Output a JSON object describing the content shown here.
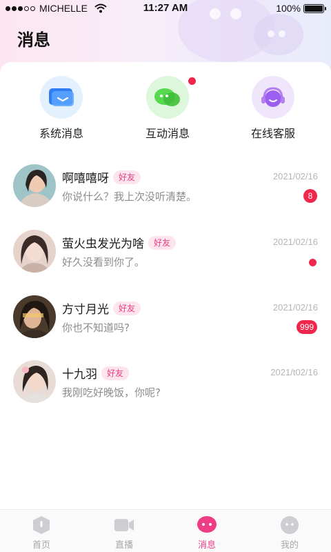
{
  "status_bar": {
    "carrier": "MICHELLE",
    "time": "11:27 AM",
    "battery": "100%"
  },
  "header": {
    "title": "消息"
  },
  "quick_entries": [
    {
      "label": "系统消息",
      "icon": "system-message-icon"
    },
    {
      "label": "互动消息",
      "icon": "interaction-message-icon",
      "has_dot": true
    },
    {
      "label": "在线客服",
      "icon": "customer-service-icon"
    }
  ],
  "messages": [
    {
      "name": "啊嘻嘻呀",
      "tag": "好友",
      "date": "2021/02/16",
      "preview": "你说什么？我上次没听清楚。",
      "badge": "8"
    },
    {
      "name": "萤火虫发光为啥",
      "tag": "好友",
      "date": "2021/02/16",
      "preview": "好久没看到你了。",
      "badge_dot": true
    },
    {
      "name": "方寸月光",
      "tag": "好友",
      "date": "2021/02/16",
      "preview": "你也不知道吗?",
      "badge": "999"
    },
    {
      "name": "十九羽",
      "tag": "好友",
      "date": "2021/t02/16",
      "preview": "我刚吃好晚饭，你呢?"
    }
  ],
  "tabbar": [
    {
      "label": "首页",
      "icon": "home-icon"
    },
    {
      "label": "直播",
      "icon": "live-camera-icon"
    },
    {
      "label": "消息",
      "icon": "message-icon",
      "active": true
    },
    {
      "label": "我的",
      "icon": "profile-icon"
    }
  ],
  "colors": {
    "accent": "#ee3c86",
    "badge_red": "#f0264d",
    "tag_bg": "#fde4ee",
    "tag_text": "#e8407c"
  }
}
